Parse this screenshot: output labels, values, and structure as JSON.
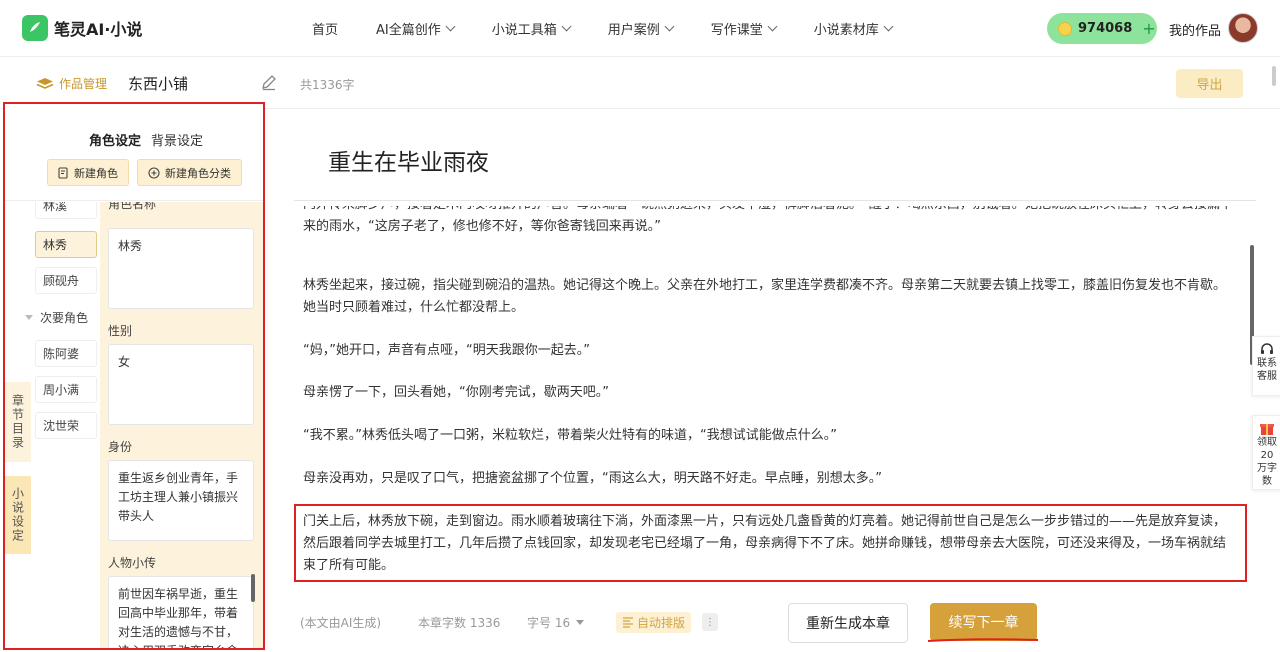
{
  "brand": {
    "name": "笔灵AI·小说",
    "color": "#3cc565"
  },
  "nav": {
    "items": [
      {
        "label": "首页",
        "dropdown": false
      },
      {
        "label": "AI全篇创作",
        "dropdown": true
      },
      {
        "label": "小说工具箱",
        "dropdown": true
      },
      {
        "label": "用户案例",
        "dropdown": true
      },
      {
        "label": "写作课堂",
        "dropdown": true
      },
      {
        "label": "小说素材库",
        "dropdown": true
      }
    ],
    "coins": "974068",
    "coin_plus": "+",
    "my_works": "我的作品"
  },
  "subbar": {
    "work_manage": "作品管理",
    "work_title": "东西小铺",
    "word_total": "共1336字",
    "export": "导出"
  },
  "left_panel": {
    "tabs": [
      "角色设定",
      "背景设定"
    ],
    "buttons": {
      "new_character": "新建角色",
      "new_category": "新建角色分类"
    },
    "partial_top_item": "林溪",
    "characters_main": [
      "林秀",
      "顾砚舟"
    ],
    "group_secondary": "次要角色",
    "characters_secondary": [
      "陈阿婆",
      "周小满",
      "沈世荣"
    ],
    "side_tabs": [
      "章节目录",
      "小说设定"
    ],
    "fields": {
      "name_label": "角色名称",
      "name_value": "林秀",
      "gender_label": "性别",
      "gender_value": "女",
      "identity_label": "身份",
      "identity_value": "重生返乡创业青年，手工坊主理人兼小镇振兴带头人",
      "bio_label": "人物小传",
      "bio_value": "前世因车祸早逝，重生回高中毕业那年，带着对生活的遗憾与不甘，决心用双手改变家乡命"
    }
  },
  "editor": {
    "chapter_title": "重生在毕业雨夜",
    "paragraphs": [
      "门外传来脚步声，接着是木门吱呀推开的声音。母亲端着一碗热粥进来，头发半湿，裤脚沾着泥。“醒了？喝点东西，别饿着。”她把碗放在床头柜上，转身去接漏下来的雨水，“这房子老了，修也修不好，等你爸寄钱回来再说。”",
      "林秀坐起来，接过碗，指尖碰到碗沿的温热。她记得这个晚上。父亲在外地打工，家里连学费都凑不齐。母亲第二天就要去镇上找零工，膝盖旧伤复发也不肯歇。她当时只顾着难过，什么忙都没帮上。",
      "“妈，”她开口，声音有点哑，“明天我跟你一起去。”",
      "母亲愣了一下，回头看她，“你刚考完试，歇两天吧。”",
      "“我不累。”林秀低头喝了一口粥，米粒软烂，带着柴火灶特有的味道，“我想试试能做点什么。”",
      "母亲没再劝，只是叹了口气，把搪瓷盆挪了个位置，“雨这么大，明天路不好走。早点睡，别想太多。”",
      "门关上后，林秀放下碗，走到窗边。雨水顺着玻璃往下淌，外面漆黑一片，只有远处几盏昏黄的灯亮着。她记得前世自己是怎么一步步错过的——先是放弃复读，然后跟着同学去城里打工，几年后攒了点钱回家，却发现老宅已经塌了一角，母亲病得下不了床。她拼命赚钱，想带母亲去大医院，可还没来得及，一场车祸就结束了所有可能。"
    ]
  },
  "float_buttons": {
    "service": "联系客服",
    "reward": "领取20万字数"
  },
  "footer": {
    "ai_note": "(本文由AI生成)",
    "chapter_count": "本章字数 1336",
    "font_size": "字号 16",
    "auto_layout": "自动排版",
    "more": "⋮",
    "regenerate": "重新生成本章",
    "continue": "续写下一章"
  },
  "colors": {
    "accent": "#d6a13a",
    "highlight_border": "#e02020",
    "panel_bg": "#fdf3dd"
  }
}
